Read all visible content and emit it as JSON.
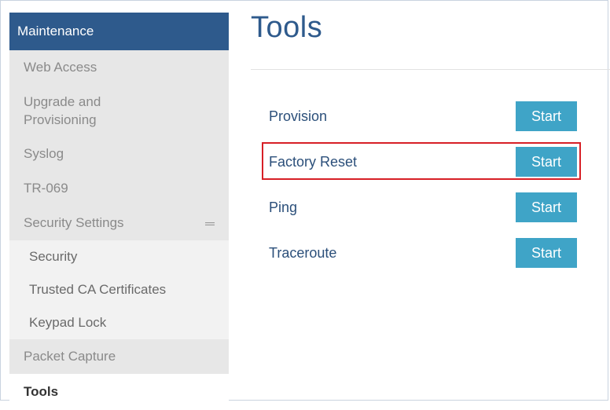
{
  "sidebar": {
    "header": "Maintenance",
    "items": [
      {
        "label": "Web Access"
      },
      {
        "label": "Upgrade and\nProvisioning"
      },
      {
        "label": "Syslog"
      },
      {
        "label": "TR-069"
      },
      {
        "label": "Security Settings",
        "icon": "minus-icon"
      },
      {
        "label": "Security"
      },
      {
        "label": "Trusted CA Certificates"
      },
      {
        "label": "Keypad Lock"
      },
      {
        "label": "Packet Capture"
      },
      {
        "label": "Tools"
      }
    ]
  },
  "main": {
    "title": "Tools",
    "tools": [
      {
        "label": "Provision",
        "button": "Start"
      },
      {
        "label": "Factory Reset",
        "button": "Start"
      },
      {
        "label": "Ping",
        "button": "Start"
      },
      {
        "label": "Traceroute",
        "button": "Start"
      }
    ]
  },
  "colors": {
    "header_bg": "#2e5a8c",
    "button_bg": "#3fa4c7",
    "highlight": "#d71f26"
  }
}
